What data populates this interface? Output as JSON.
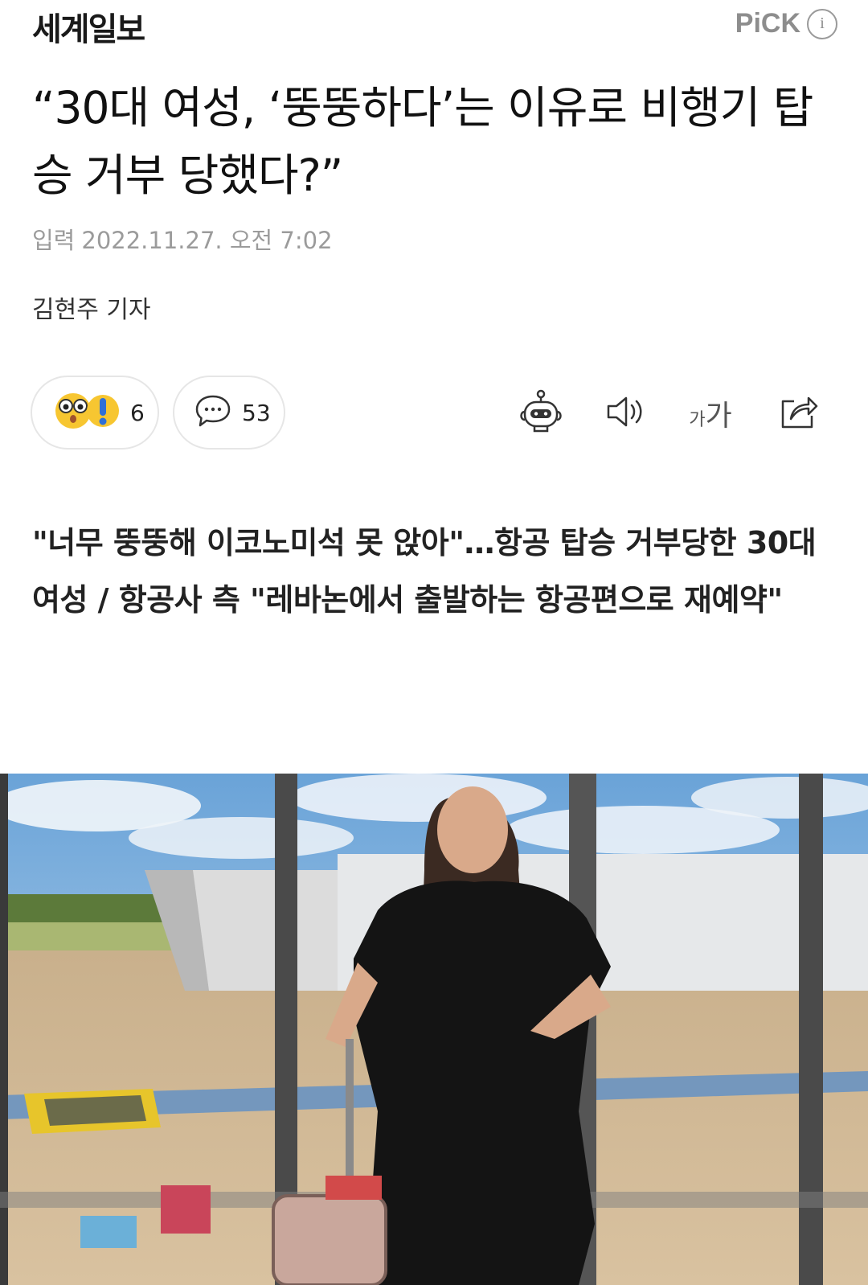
{
  "header": {
    "publisher": "세계일보",
    "pick_label": "PiCK",
    "info_glyph": "i"
  },
  "article": {
    "headline": "“30대 여성, ‘뚱뚱하다’는 이유로 비행기 탑승 거부 당했다?”",
    "date_label": "입력",
    "date": "2022.11.27. 오전 7:02",
    "author": "김현주 기자",
    "summary": "\"너무 뚱뚱해 이코노미석 못 앉아\"…항공 탑승 거부당한 30대 여성 / 항공사 측 \"레바논에서 출발하는 항공편으로 재예약\""
  },
  "reactions": {
    "reaction_count": "6",
    "comment_count": "53",
    "reaction_icon": "surprised-emoji-icon",
    "comment_icon": "speech-bubble-icon"
  },
  "toolbar": {
    "icons": [
      "robot-summary-icon",
      "speaker-icon",
      "font-size-icon",
      "share-icon"
    ],
    "font_small": "가",
    "font_large": "가"
  },
  "photo": {
    "description_icon": "article-photo"
  },
  "colors": {
    "muted": "#9b9b9b",
    "border": "#e6e6e6",
    "emoji_yellow": "#f7c631",
    "exclaim_blue": "#2f6fd6"
  }
}
